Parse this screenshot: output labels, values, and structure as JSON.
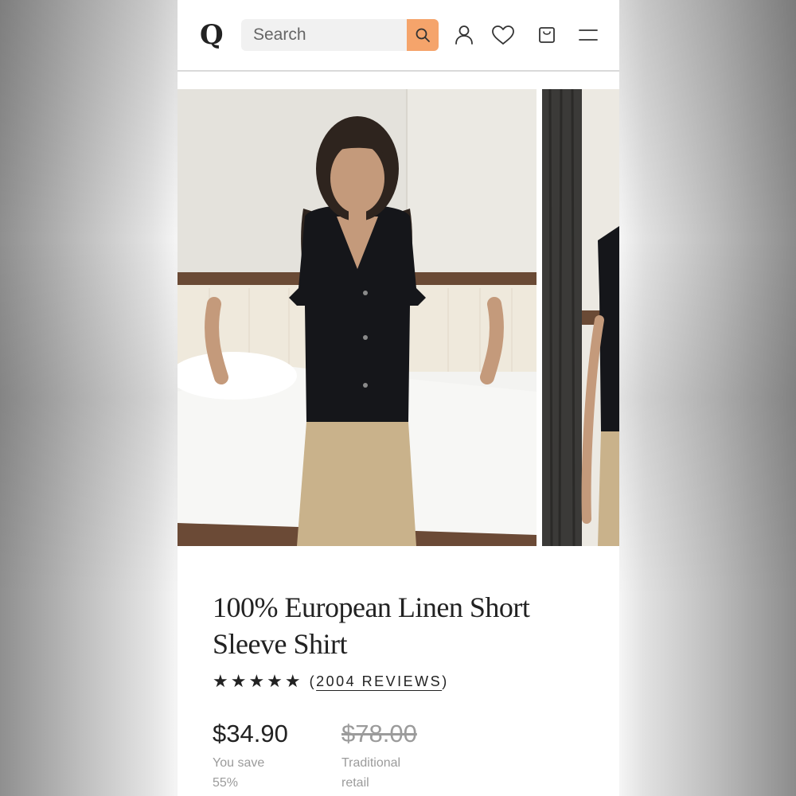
{
  "header": {
    "logo": "Q",
    "search": {
      "placeholder": "Search"
    },
    "icons": [
      "search-icon",
      "account-icon",
      "heart-icon",
      "bag-icon",
      "menu-icon"
    ],
    "accent_color": "#f5a46b"
  },
  "gallery": {
    "images": [
      "product-photo-front",
      "product-photo-side"
    ]
  },
  "product": {
    "title": "100% European Linen Short Sleeve Shirt",
    "rating_stars": "★★★★★",
    "reviews_open": "(",
    "reviews_text": "2004 REVIEWS",
    "reviews_close": ")",
    "price": "$34.90",
    "savings_line1": "You save",
    "savings_line2": "55%",
    "original_price": "$78.00",
    "retail_line1": "Traditional",
    "retail_line2": "retail"
  }
}
